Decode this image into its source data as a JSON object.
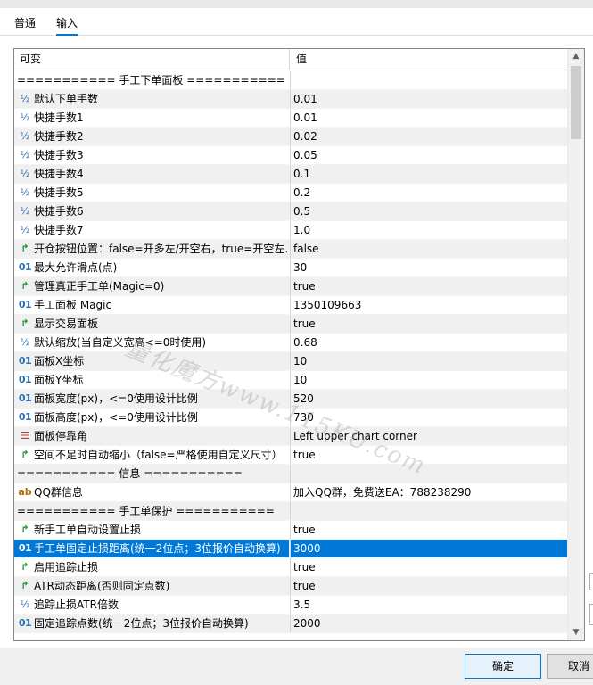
{
  "tabs": [
    {
      "label": "普通"
    },
    {
      "label": "输入"
    }
  ],
  "grid": {
    "header": {
      "col_variable": "可变",
      "col_value": "值"
    },
    "rows": [
      {
        "type": "section",
        "label": "=========== 手工下单面板 ===========",
        "value": ""
      },
      {
        "type": "frac",
        "label": "默认下单手数",
        "value": "0.01"
      },
      {
        "type": "frac",
        "label": "快捷手数1",
        "value": "0.01"
      },
      {
        "type": "frac",
        "label": "快捷手数2",
        "value": "0.02"
      },
      {
        "type": "frac",
        "label": "快捷手数3",
        "value": "0.05"
      },
      {
        "type": "frac",
        "label": "快捷手数4",
        "value": "0.1"
      },
      {
        "type": "frac",
        "label": "快捷手数5",
        "value": "0.2"
      },
      {
        "type": "frac",
        "label": "快捷手数6",
        "value": "0.5"
      },
      {
        "type": "frac",
        "label": "快捷手数7",
        "value": "1.0"
      },
      {
        "type": "bool",
        "label": "开仓按钮位置：false=开多左/开空右，true=开空左...",
        "value": "false"
      },
      {
        "type": "bin",
        "label": "最大允许滑点(点)",
        "value": "30"
      },
      {
        "type": "bool",
        "label": "管理真正手工单(Magic=0)",
        "value": "true"
      },
      {
        "type": "bin",
        "label": "手工面板 Magic",
        "value": "1350109663"
      },
      {
        "type": "bool",
        "label": "显示交易面板",
        "value": "true"
      },
      {
        "type": "frac",
        "label": "默认缩放(当自定义宽高<=0时使用)",
        "value": "0.68"
      },
      {
        "type": "bin",
        "label": "面板X坐标",
        "value": "10"
      },
      {
        "type": "bin",
        "label": "面板Y坐标",
        "value": "10"
      },
      {
        "type": "bin",
        "label": "面板宽度(px)，<=0使用设计比例",
        "value": "520"
      },
      {
        "type": "bin",
        "label": "面板高度(px)，<=0使用设计比例",
        "value": "730"
      },
      {
        "type": "enum",
        "label": "面板停靠角",
        "value": "Left upper chart corner"
      },
      {
        "type": "bool",
        "label": "空间不足时自动缩小（false=严格使用自定义尺寸）",
        "value": "true"
      },
      {
        "type": "section",
        "label": "=========== 信息 ===========",
        "value": ""
      },
      {
        "type": "str",
        "label": "QQ群信息",
        "value": "加入QQ群，免费送EA：788238290"
      },
      {
        "type": "section",
        "label": "=========== 手工单保护 ===========",
        "value": ""
      },
      {
        "type": "bool",
        "label": "新手工单自动设置止损",
        "value": "true"
      },
      {
        "type": "bin",
        "label": "手工单固定止损距离(统一2位点；3位报价自动换算)",
        "value": "3000",
        "selected": true
      },
      {
        "type": "bool",
        "label": "启用追踪止损",
        "value": "true"
      },
      {
        "type": "bool",
        "label": "ATR动态距离(否则固定点数)",
        "value": "true"
      },
      {
        "type": "frac",
        "label": "追踪止损ATR倍数",
        "value": "3.5"
      },
      {
        "type": "bin",
        "label": "固定追踪点数(统一2位点；3位报价自动换算)",
        "value": "2000"
      }
    ]
  },
  "icons": {
    "frac": "½",
    "bin": "01",
    "bool": "↱",
    "enum": "☰",
    "str": "ab"
  },
  "watermark": "量化魔方www.115KU.com",
  "buttons": {
    "ok": "确定",
    "cancel": "取消"
  },
  "colors": {
    "selection": "#0078d7",
    "accent": "#0078d7"
  }
}
